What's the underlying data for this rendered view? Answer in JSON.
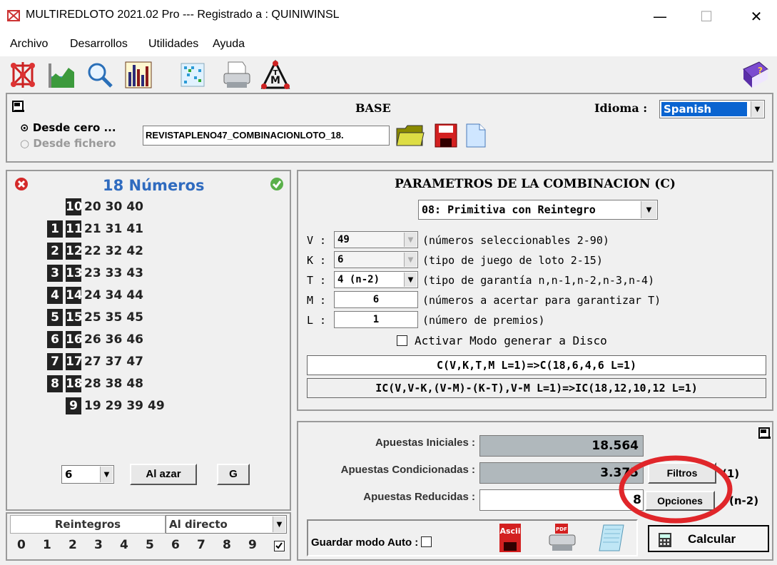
{
  "window": {
    "title": "MULTIREDLOTO 2021.02 Pro --- Registrado a : QUINIWINSL",
    "minimize": "—",
    "maximize": "☐",
    "close": "✕"
  },
  "menu": [
    "Archivo",
    "Desarrollos",
    "Utilidades",
    "Ayuda"
  ],
  "toolbar_icons": [
    "network-icon",
    "chart-icon",
    "magnifier-icon",
    "bar-chart-icon",
    "grid-icon",
    "printer-icon",
    "tm-icon",
    "help-book-icon"
  ],
  "base": {
    "title": "BASE",
    "idioma_label": "Idioma :",
    "idioma_value": "Spanish",
    "radio_desde_cero": "Desde cero ...",
    "radio_desde_fichero": "Desde fichero",
    "file_value": "REVISTAPLENO47_COMBINACIONLOTO_18."
  },
  "numbers": {
    "title": "18 Números",
    "rows": [
      {
        "box": [
          "10"
        ],
        "plain": [
          "20",
          "30",
          "40"
        ]
      },
      {
        "box": [
          "1",
          "11"
        ],
        "plain": [
          "21",
          "31",
          "41"
        ]
      },
      {
        "box": [
          "2",
          "12"
        ],
        "plain": [
          "22",
          "32",
          "42"
        ]
      },
      {
        "box": [
          "3",
          "13"
        ],
        "plain": [
          "23",
          "33",
          "43"
        ]
      },
      {
        "box": [
          "4",
          "14"
        ],
        "plain": [
          "24",
          "34",
          "44"
        ]
      },
      {
        "box": [
          "5",
          "15"
        ],
        "plain": [
          "25",
          "35",
          "45"
        ]
      },
      {
        "box": [
          "6",
          "16"
        ],
        "plain": [
          "26",
          "36",
          "46"
        ]
      },
      {
        "box": [
          "7",
          "17"
        ],
        "plain": [
          "27",
          "37",
          "47"
        ]
      },
      {
        "box": [
          "8",
          "18"
        ],
        "plain": [
          "28",
          "38",
          "48"
        ]
      },
      {
        "box": [
          "9"
        ],
        "plain": [
          "19",
          "29",
          "39",
          "49"
        ]
      }
    ],
    "count_select": "6",
    "al_azar": "Al azar",
    "g_button": "G"
  },
  "reintegros": {
    "label": "Reintegros",
    "mode": "Al directo",
    "digits": [
      "0",
      "1",
      "2",
      "3",
      "4",
      "5",
      "6",
      "7",
      "8",
      "9"
    ]
  },
  "params": {
    "title": "PARAMETROS DE LA COMBINACION (C)",
    "game_select": "08: Primitiva con Reintegro",
    "rows": [
      {
        "key": "V :",
        "value": "49",
        "desc": "(números seleccionables 2-90)"
      },
      {
        "key": "K :",
        "value": "6",
        "desc": "(tipo de juego de loto 2-15)"
      },
      {
        "key": "T :",
        "value": "4 (n-2)",
        "desc": "(tipo de garantía n,n-1,n-2,n-3,n-4)"
      },
      {
        "key": "M :",
        "value": "6",
        "desc": "(números a acertar para garantizar T)"
      },
      {
        "key": "L :",
        "value": "1",
        "desc": "(número de premios)"
      }
    ],
    "disco_label": "Activar Modo generar a Disco",
    "formula1": "C(V,K,T,M L=1)=>C(18,6,4,6 L=1)",
    "formula2": "IC(V,V-K,(V-M)-(K-T),V-M L=1)=>IC(18,12,10,12 L=1)"
  },
  "results": {
    "iniciales_label": "Apuestas Iniciales :",
    "iniciales_value": "18.564",
    "condicionadas_label": "Apuestas Condicionadas :",
    "condicionadas_value": "3.375",
    "filtros_button": "Filtros",
    "filtros_suffix": "(1)",
    "reducidas_label": "Apuestas Reducidas :",
    "reducidas_value": "8",
    "opciones_button": "Opciones",
    "opciones_suffix": "(n-2)",
    "guardar_label": "Guardar modo Auto :",
    "calcular_button": "Calcular",
    "highlight_color": "#e0262a"
  }
}
